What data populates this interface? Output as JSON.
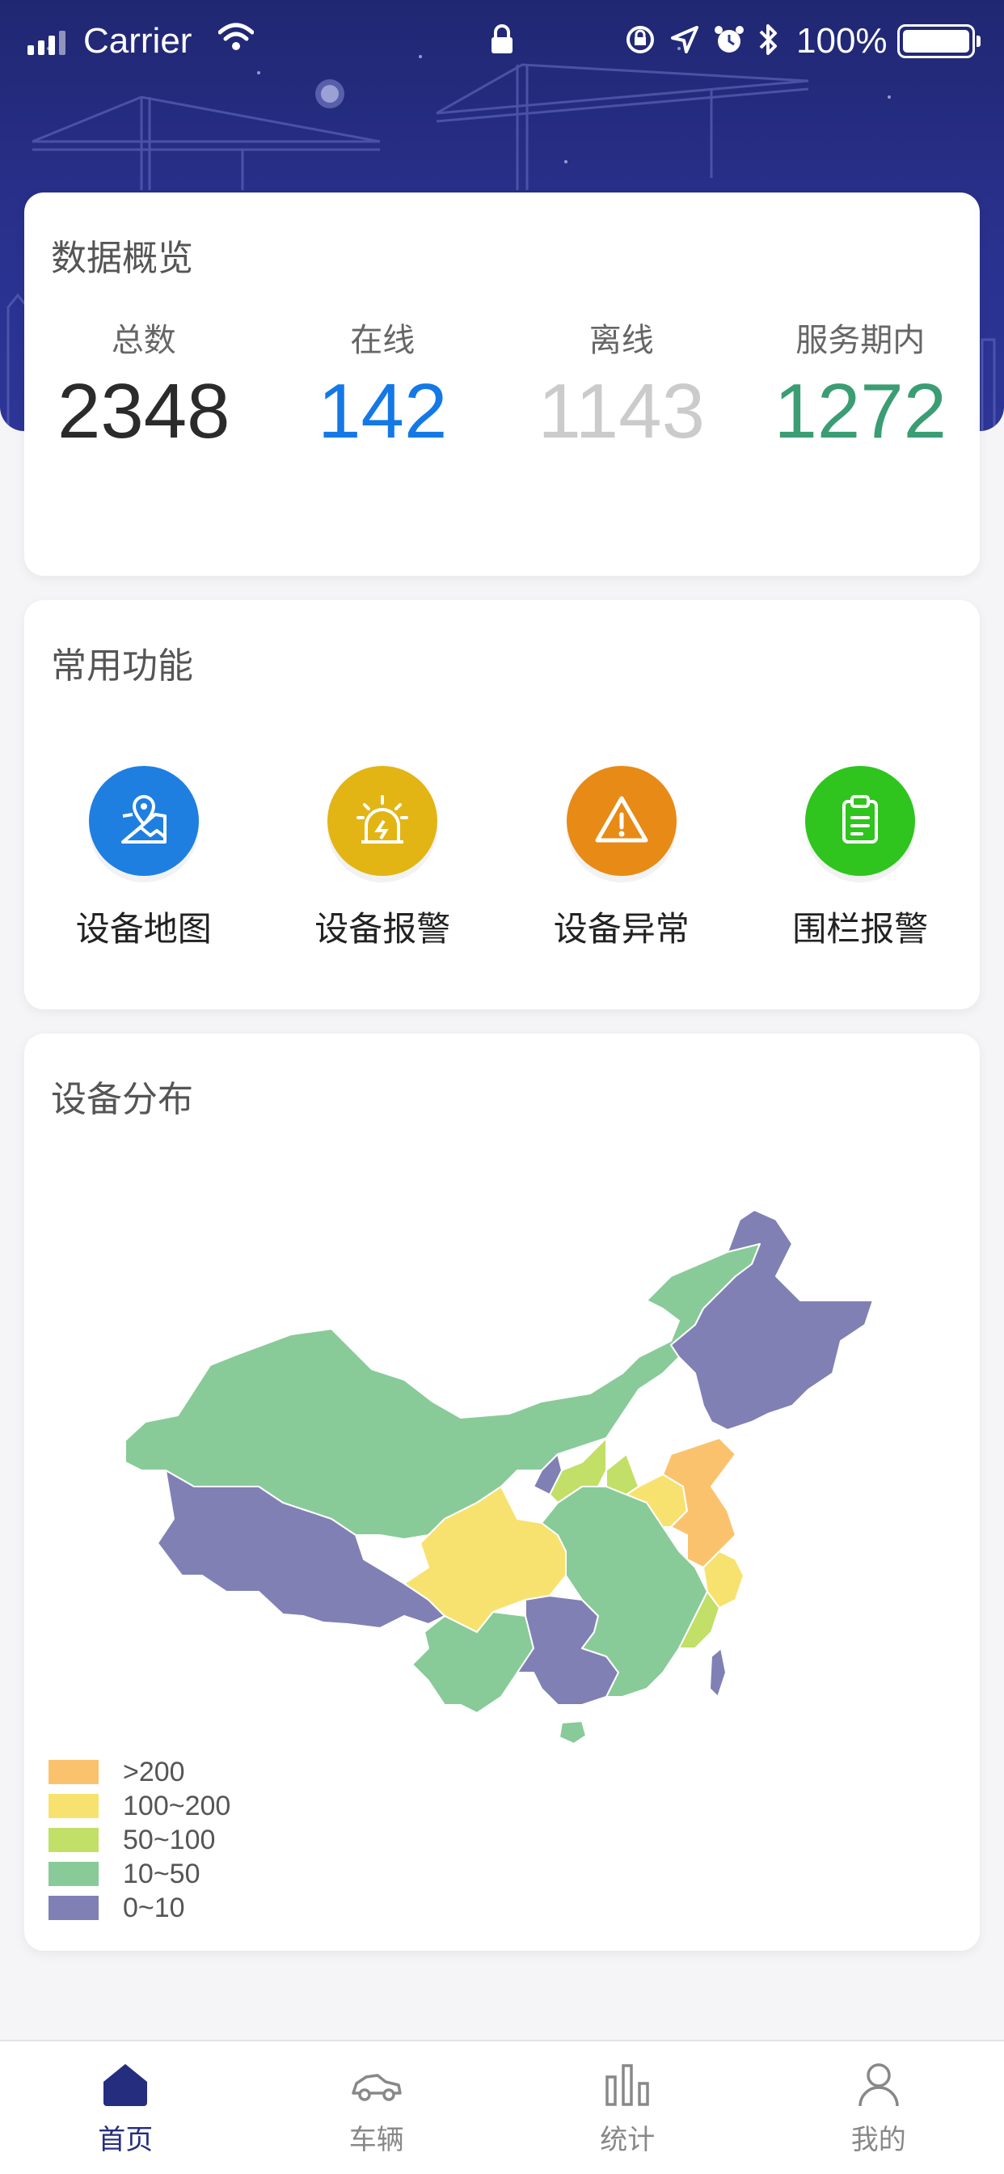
{
  "status_bar": {
    "carrier": "Carrier",
    "battery": "100%"
  },
  "overview": {
    "title": "数据概览",
    "stats": [
      {
        "label": "总数",
        "value": "2348",
        "color": "#2b2b2b"
      },
      {
        "label": "在线",
        "value": "142",
        "color": "#1478e6"
      },
      {
        "label": "离线",
        "value": "1143",
        "color": "#cbcbcb"
      },
      {
        "label": "服务期内",
        "value": "1272",
        "color": "#3a9d73"
      }
    ]
  },
  "functions": {
    "title": "常用功能",
    "items": [
      {
        "label": "设备地图",
        "icon": "map-pin-icon",
        "color": "#1e7fe0"
      },
      {
        "label": "设备报警",
        "icon": "alarm-light-icon",
        "color": "#e2b514"
      },
      {
        "label": "设备异常",
        "icon": "warning-icon",
        "color": "#e88a16"
      },
      {
        "label": "围栏报警",
        "icon": "clipboard-icon",
        "color": "#30c41e"
      }
    ]
  },
  "distribution": {
    "title": "设备分布",
    "legend": [
      {
        "label": ">200",
        "color": "#fbc26e"
      },
      {
        "label": "100~200",
        "color": "#f8e26f"
      },
      {
        "label": "50~100",
        "color": "#c2df67"
      },
      {
        "label": "10~50",
        "color": "#88cb98"
      },
      {
        "label": "0~10",
        "color": "#8080b5"
      }
    ]
  },
  "tabbar": {
    "tabs": [
      {
        "label": "首页",
        "icon": "home-icon",
        "active": true
      },
      {
        "label": "车辆",
        "icon": "car-icon",
        "active": false
      },
      {
        "label": "统计",
        "icon": "bar-chart-icon",
        "active": false
      },
      {
        "label": "我的",
        "icon": "user-icon",
        "active": false
      }
    ]
  }
}
